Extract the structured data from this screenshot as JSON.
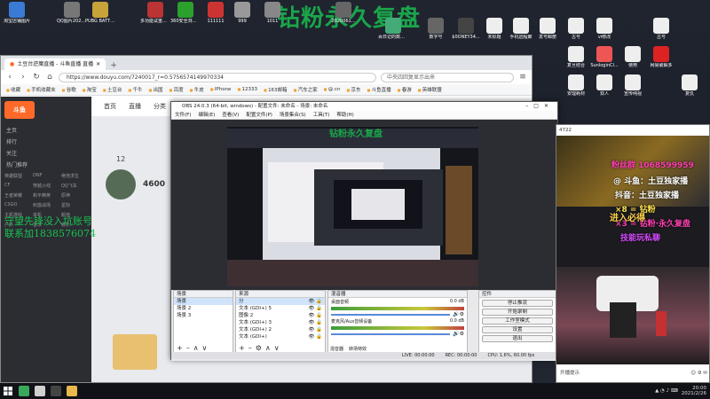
{
  "desktop": {
    "overlay_title": "钻粉永久复盘",
    "icons": [
      {
        "label": "淘宝店铺图片",
        "color": "#3a7bd5"
      },
      {
        "label": "QQ图片2021020...",
        "color": "#777"
      },
      {
        "label": "PUBG BATTLEGR...",
        "color": "#c9a23a"
      },
      {
        "label": "多功能试重复生成",
        "color": "#b33"
      },
      {
        "label": "360安全浏览器",
        "color": "#2ca02c"
      },
      {
        "label": "111111",
        "color": "#c33"
      },
      {
        "label": "999",
        "color": "#999"
      },
      {
        "label": "1011",
        "color": "#888"
      },
      {
        "label": "2020061...",
        "color": "#666"
      },
      {
        "label": "百日记的数字音",
        "color": "#4a7"
      },
      {
        "label": "数字号",
        "color": "#666"
      },
      {
        "label": "$0ONEY34...",
        "color": "#444"
      },
      {
        "label": "未标题",
        "color": "#eee"
      },
      {
        "label": "手机远程聚",
        "color": "#eee"
      },
      {
        "label": "发号邮册",
        "color": "#eee"
      },
      {
        "label": "古号",
        "color": "#eee"
      },
      {
        "label": "vi修改",
        "color": "#eee"
      },
      {
        "label": "古号",
        "color": "#eee"
      },
      {
        "label": "复旦结合",
        "color": "#eee"
      },
      {
        "label": "SunloginCl...",
        "color": "#e55"
      },
      {
        "label": "使用",
        "color": "#eee"
      },
      {
        "label": "网易破解多",
        "color": "#d22"
      },
      {
        "label": "安理耗材",
        "color": "#eee"
      },
      {
        "label": "双人",
        "color": "#eee"
      },
      {
        "label": "宣传纯视",
        "color": "#eee"
      },
      {
        "label": "复仇",
        "color": "#eee"
      }
    ]
  },
  "browser": {
    "tab_title": "土豆台逆魔直播 - 斗鱼直播 直播",
    "url": "https://www.douyu.com/7240017_r=0.5756574149970334",
    "search_placeholder": "中央四回复显示出来",
    "bookmarks": [
      "收藏",
      "手机收藏夹",
      "谷歌",
      "淘宝",
      "土豆台",
      "千牛",
      "出国",
      "百度",
      "牛皮",
      "IPhone",
      "12333",
      "163邮箱",
      "汽车之家",
      "@.cn",
      "京东",
      "斗鱼直播",
      "春游",
      "英雄联盟"
    ],
    "site_logo": "斗鱼",
    "top_nav": [
      "首页",
      "直播",
      "分类",
      "鱼吧"
    ],
    "sidebar_items": [
      "主页",
      "排行",
      "关注",
      "热门推荐"
    ],
    "sidebar_grid": [
      "英雄联盟",
      "DNF",
      "绝地求生",
      "CF",
      "穿越火线",
      "QQ飞车",
      "王者荣耀",
      "和平精英",
      "原神",
      "CSGO",
      "刺激战场",
      "星际",
      "主机游戏",
      "单机",
      "颜值",
      "户外",
      "音乐",
      "娱乐"
    ],
    "overlay_line1": "守望先锋没入坑账号",
    "overlay_line2": "联系加1838576074",
    "streamer_fans": "4600",
    "streamer_count": "12"
  },
  "obs": {
    "title": "OBS 24.0.3 (64-bit, windows) - 配置文件: 未命名 - 场景: 未命名",
    "menu": [
      "文件(F)",
      "编辑(E)",
      "查看(V)",
      "配置文件(P)",
      "场景集合(S)",
      "工具(T)",
      "帮助(H)"
    ],
    "preview_overlay": "钻粉永久复盘",
    "scenes_header": "场景",
    "scenes": [
      "场景",
      "场景 2",
      "场景 3"
    ],
    "sources_header": "来源",
    "sources": [
      "分",
      "文本 (GDI+) 5",
      "图像 2",
      "文本 (GDI+) 3",
      "文本 (GDI+) 2",
      "文本 (GDI+)"
    ],
    "mixer_header": "混音器",
    "mixer_tracks": [
      {
        "name": "桌面音频",
        "db": "0.0 dB"
      },
      {
        "name": "麦克风/Aux音频设备",
        "db": "0.0 dB"
      }
    ],
    "bottom_tabs": [
      "混音器",
      "转场特效"
    ],
    "controls_header": "控件",
    "controls": [
      "停止推流",
      "开始录制",
      "工作室模式",
      "设置",
      "退出"
    ],
    "status": {
      "live": "LIVE: 00:00:00",
      "rec": "REC: 00:00:00",
      "cpu": "CPU: 1.6%, 60.00 fps"
    }
  },
  "rightwin": {
    "title": "4722",
    "lines": [
      {
        "text": "粉丝群 1068599959",
        "color": "#ff3fb0"
      },
      {
        "text": "@ 斗鱼：土豆独家播",
        "color": "#ffffff"
      },
      {
        "text": "抖音：土豆独家播",
        "color": "#ffffff"
      },
      {
        "text": "×8 = 钻粉",
        "color": "#ffe04a"
      },
      {
        "text": "×3 = 钻粉·永久复盘",
        "color": "#ff3fb0"
      },
      {
        "text": "技能玩私聊",
        "color": "#d84bff"
      }
    ],
    "bottom_left": "开播提示",
    "banner": "进入必得"
  },
  "taskbar": {
    "time": "20:00",
    "date": "2021/2/26"
  }
}
